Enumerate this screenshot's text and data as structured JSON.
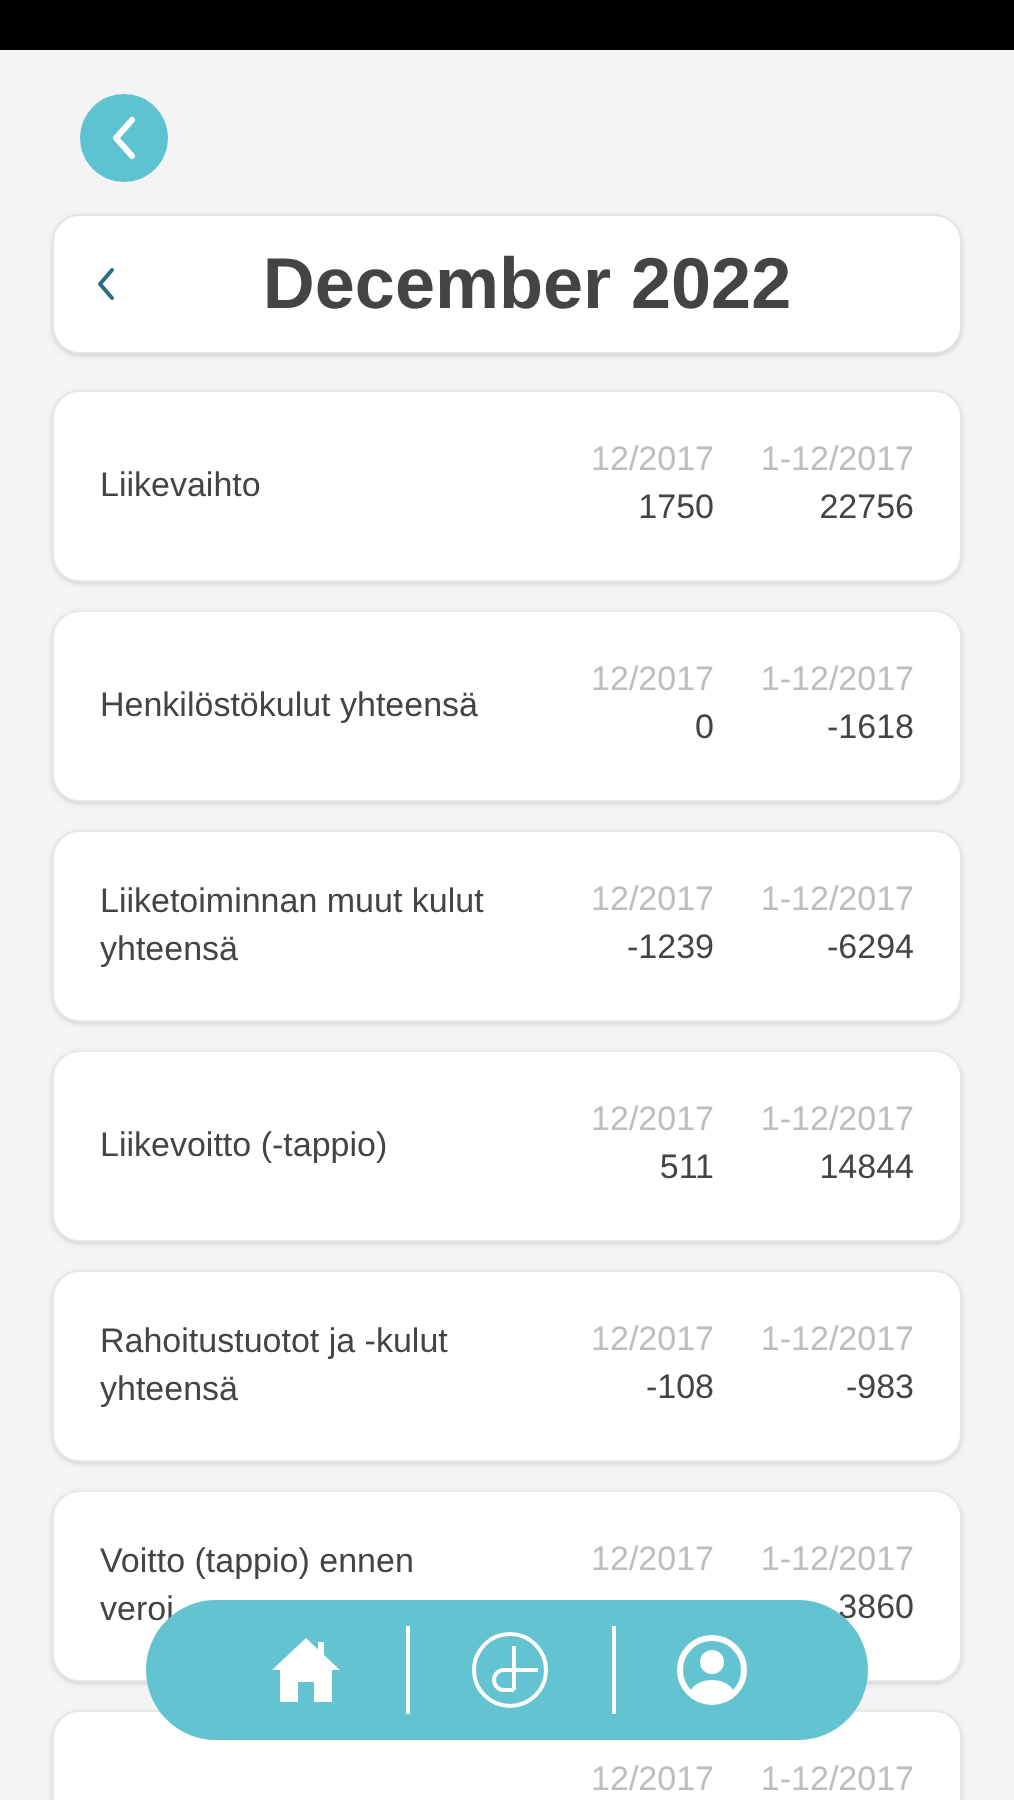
{
  "header": {
    "title": "December 2022"
  },
  "rows": [
    {
      "label": "Liikevaihto",
      "columns": [
        {
          "period": "12/2017",
          "value": "1750"
        },
        {
          "period": "1-12/2017",
          "value": "22756"
        }
      ]
    },
    {
      "label": "Henkilöstökulut yhteensä",
      "columns": [
        {
          "period": "12/2017",
          "value": "0"
        },
        {
          "period": "1-12/2017",
          "value": "-1618"
        }
      ]
    },
    {
      "label": "Liiketoiminnan muut kulut yhteensä",
      "columns": [
        {
          "period": "12/2017",
          "value": "-1239"
        },
        {
          "period": "1-12/2017",
          "value": "-6294"
        }
      ]
    },
    {
      "label": "Liikevoitto (-tappio)",
      "columns": [
        {
          "period": "12/2017",
          "value": "511"
        },
        {
          "period": "1-12/2017",
          "value": "14844"
        }
      ]
    },
    {
      "label": "Rahoitustuotot ja -kulut yhteensä",
      "columns": [
        {
          "period": "12/2017",
          "value": "-108"
        },
        {
          "period": "1-12/2017",
          "value": "-983"
        }
      ]
    },
    {
      "label": "Voitto (tappio) ennen veroi",
      "columns": [
        {
          "period": "12/2017"
        },
        {
          "period": "1-12/2017",
          "value": "3860"
        }
      ]
    },
    {
      "columns": [
        {
          "period": "12/2017"
        },
        {
          "period": "1-12/2017"
        }
      ]
    }
  ],
  "nav": [
    {
      "kind": "home"
    },
    {
      "kind": "logo"
    },
    {
      "kind": "profile"
    }
  ]
}
